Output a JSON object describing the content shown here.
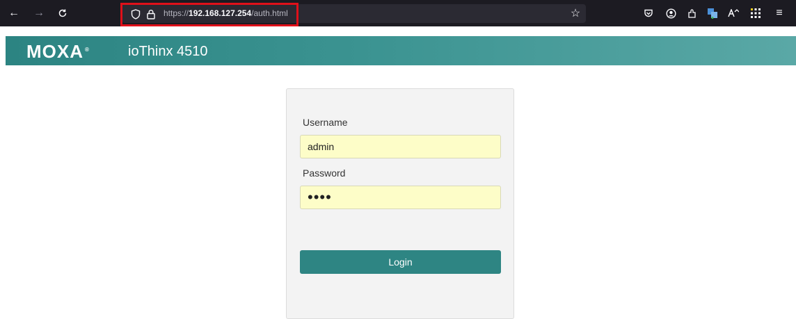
{
  "browser": {
    "url": {
      "protocol": "https://",
      "host": "192.168.127.254",
      "path": "/auth.html"
    },
    "icons": {
      "back": "←",
      "forward": "→",
      "reload": "↻",
      "shield": "⛉",
      "lock": "🔒",
      "bookmark": "☆",
      "pocket": "⛊",
      "account": "◉",
      "extensions": "⇪",
      "translate": "文",
      "font": "A",
      "apps": "⋮⋮⋮",
      "menu": "≡"
    }
  },
  "header": {
    "logo": "MOXA",
    "logo_mark": "®",
    "product": "ioThinx 4510"
  },
  "login": {
    "username_label": "Username",
    "username_value": "admin",
    "password_label": "Password",
    "password_value": "••••",
    "login_label": "Login"
  },
  "colors": {
    "accent": "#2e8583",
    "field_bg": "#fdfdc8",
    "highlight": "#e0101a"
  }
}
